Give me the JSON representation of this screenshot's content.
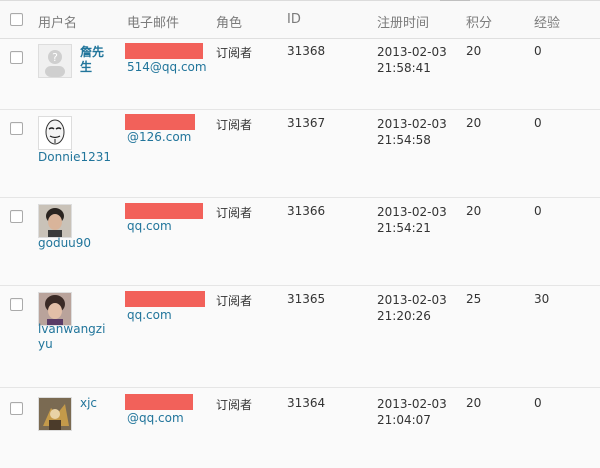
{
  "header": {
    "username": "用户名",
    "email": "电子邮件",
    "role": "角色",
    "id": "ID",
    "registered": "注册时间",
    "points": "积分",
    "experience": "经验"
  },
  "rows": [
    {
      "avatar_icon": "default-avatar-icon",
      "username": "詹先生",
      "email": "514@qq.com",
      "role": "订阅者",
      "id": "31368",
      "date": "2013-02-03",
      "time": "21:58:41",
      "points": "20",
      "experience": "0"
    },
    {
      "avatar_icon": "mask-avatar-icon",
      "username": "Donnie1231",
      "email": "@126.com",
      "role": "订阅者",
      "id": "31367",
      "date": "2013-02-03",
      "time": "21:54:58",
      "points": "20",
      "experience": "0"
    },
    {
      "avatar_icon": "photo-avatar-icon",
      "username": "goduu90",
      "email": "qq.com",
      "role": "订阅者",
      "id": "31366",
      "date": "2013-02-03",
      "time": "21:54:21",
      "points": "20",
      "experience": "0"
    },
    {
      "avatar_icon": "photo-avatar-icon",
      "username": "lvanwangziyu",
      "email": "qq.com",
      "role": "订阅者",
      "id": "31365",
      "date": "2013-02-03",
      "time": "21:20:26",
      "points": "25",
      "experience": "30"
    },
    {
      "avatar_icon": "game-avatar-icon",
      "username": "xjc",
      "email": "@qq.com",
      "role": "订阅者",
      "id": "31364",
      "date": "2013-02-03",
      "time": "21:04:07",
      "points": "20",
      "experience": "0"
    }
  ],
  "colors": {
    "link": "#21759b",
    "redaction": "#f2615a"
  }
}
